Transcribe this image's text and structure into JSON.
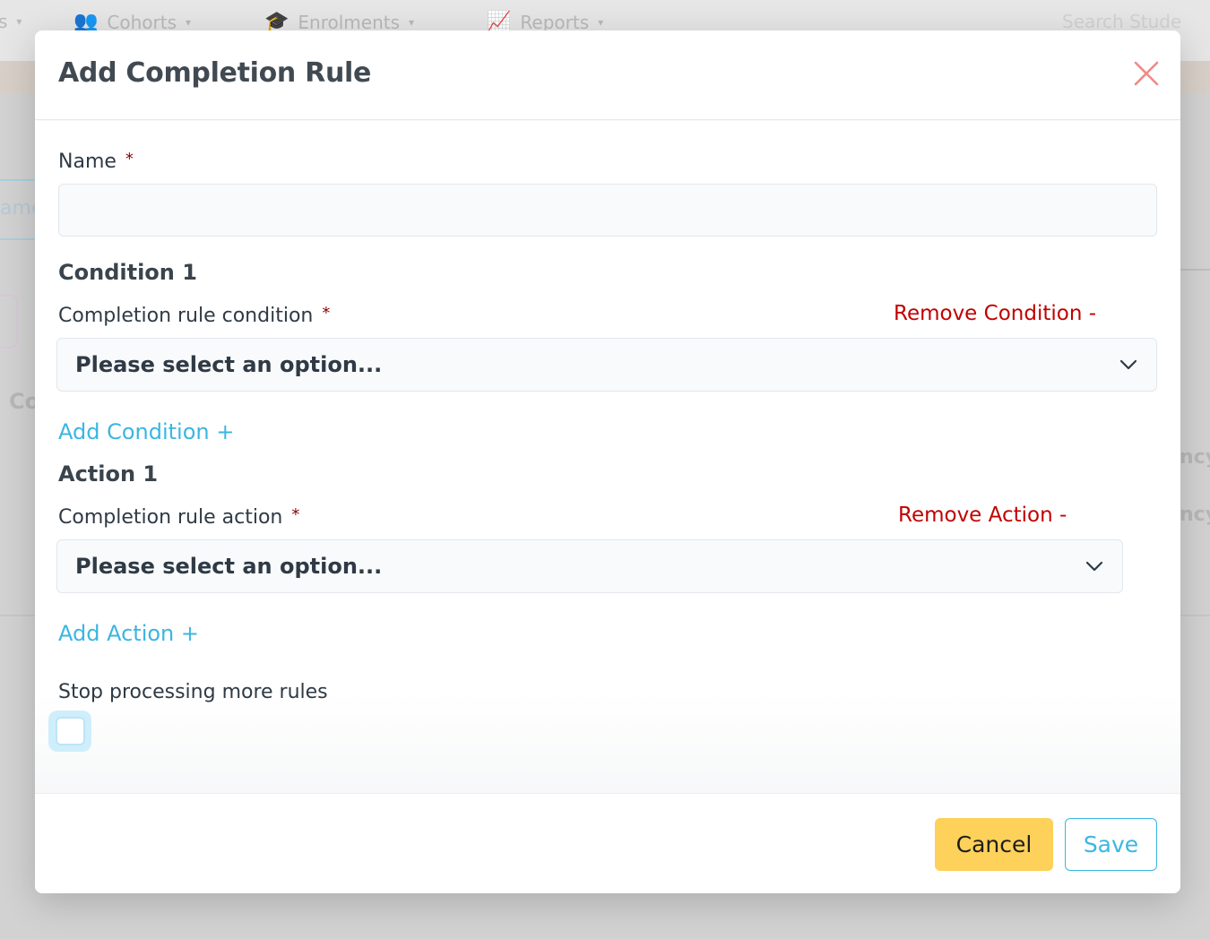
{
  "background": {
    "nav": {
      "partial_item": "s",
      "items": [
        {
          "icon": "users-icon",
          "label": "Cohorts"
        },
        {
          "icon": "graduation-cap-icon",
          "label": "Enrolments"
        },
        {
          "icon": "chart-icon",
          "label": "Reports"
        }
      ],
      "search_placeholder": "Search Stude"
    },
    "fragments": {
      "left_tab": "ame",
      "left_heading": "Co",
      "right_text_1": "ncy",
      "right_text_2": "ncy"
    }
  },
  "modal": {
    "title": "Add Completion Rule",
    "close_icon": "close-icon",
    "name_field": {
      "label": "Name",
      "required_marker": "*",
      "value": ""
    },
    "condition": {
      "section_title": "Condition 1",
      "label": "Completion rule condition",
      "required_marker": "*",
      "remove_label": "Remove Condition -",
      "select_value": "Please select an option...",
      "add_label": "Add Condition +"
    },
    "action": {
      "section_title": "Action 1",
      "label": "Completion rule action",
      "required_marker": "*",
      "remove_label": "Remove Action -",
      "select_value": "Please select an option...",
      "add_label": "Add Action +"
    },
    "stop_processing": {
      "label": "Stop processing more rules",
      "checked": false
    },
    "footer": {
      "cancel_label": "Cancel",
      "save_label": "Save"
    }
  },
  "colors": {
    "accent_blue": "#3bb6e2",
    "danger_red": "#c20000",
    "cancel_yellow": "#fdd15a",
    "close_red": "#ef8a8a"
  }
}
